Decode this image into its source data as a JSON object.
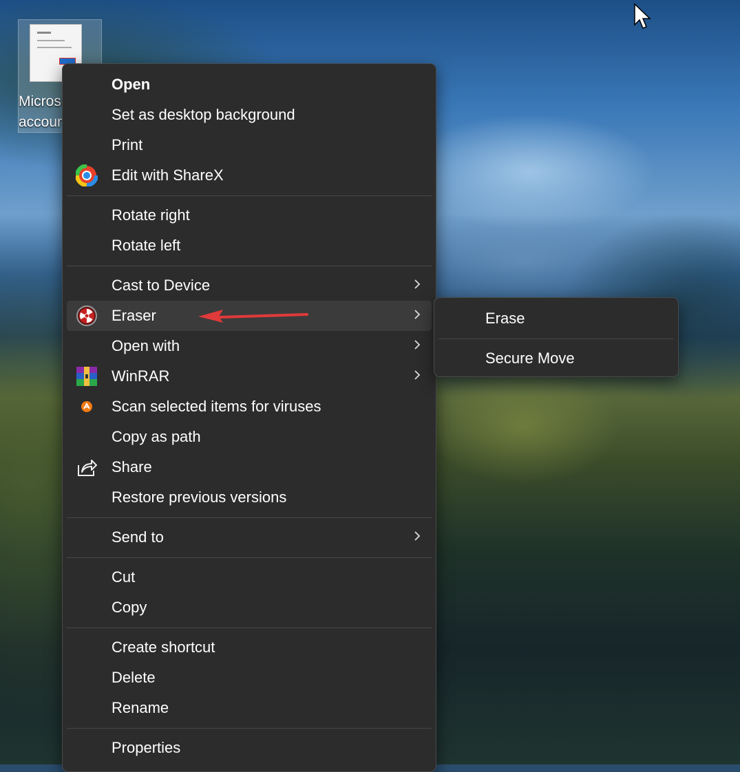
{
  "desktop": {
    "icon_label": "Microsoft account"
  },
  "context_menu": {
    "items": [
      {
        "label": "Open"
      },
      {
        "label": "Set as desktop background"
      },
      {
        "label": "Print"
      },
      {
        "label": "Edit with ShareX",
        "icon": "sharex-icon"
      },
      {
        "label": "Rotate right"
      },
      {
        "label": "Rotate left"
      },
      {
        "label": "Cast to Device"
      },
      {
        "label": "Eraser",
        "icon": "eraser-icon"
      },
      {
        "label": "Open with"
      },
      {
        "label": "WinRAR",
        "icon": "winrar-icon"
      },
      {
        "label": "Scan selected items for viruses",
        "icon": "avast-icon"
      },
      {
        "label": "Copy as path"
      },
      {
        "label": "Share",
        "icon": "share-icon"
      },
      {
        "label": "Restore previous versions"
      },
      {
        "label": "Send to"
      },
      {
        "label": "Cut"
      },
      {
        "label": "Copy"
      },
      {
        "label": "Create shortcut"
      },
      {
        "label": "Delete"
      },
      {
        "label": "Rename"
      },
      {
        "label": "Properties"
      }
    ]
  },
  "submenu": {
    "items": [
      {
        "label": "Erase"
      },
      {
        "label": "Secure Move"
      }
    ]
  },
  "colors": {
    "menu_background": "#2c2c2c",
    "highlight": "#3b3b3b",
    "annotation_arrow": "#e03a3a"
  }
}
